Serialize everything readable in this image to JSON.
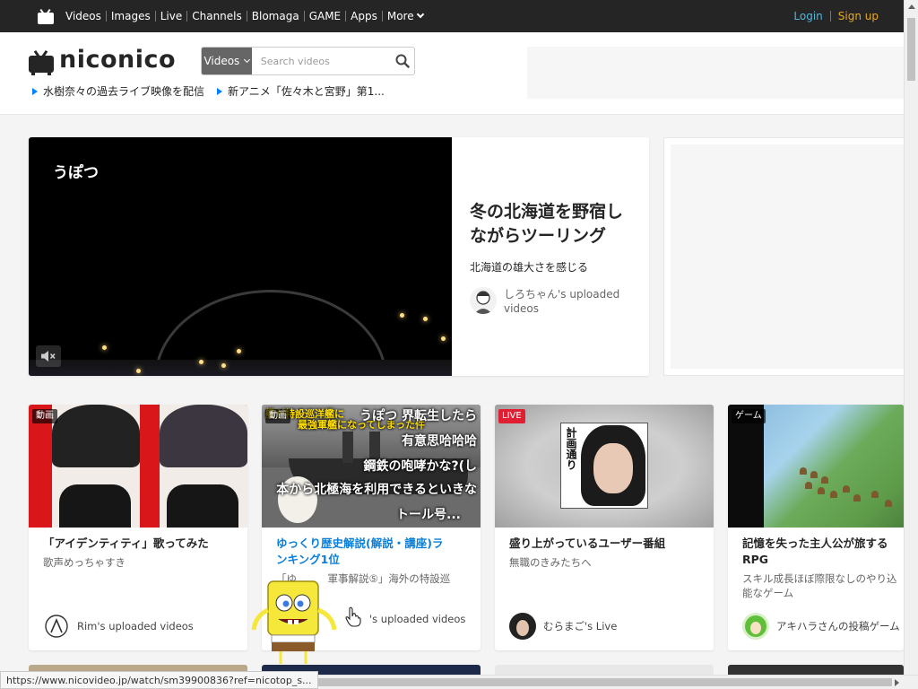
{
  "topbar": {
    "nav": [
      "Videos",
      "Images",
      "Live",
      "Channels",
      "Blomaga",
      "GAME",
      "Apps"
    ],
    "more_label": "More",
    "login": "Login",
    "signup": "Sign up"
  },
  "header": {
    "logo_text": "niconico",
    "search_category": "Videos",
    "search_placeholder": "Search videos",
    "news": [
      "水樹奈々の過去ライブ映像を配信",
      "新アニメ「佐々木と宮野」第1..."
    ]
  },
  "hero": {
    "video_label": "うぽつ",
    "title_line1": "冬の北海道を野宿し",
    "title_line2": "ながらツーリング",
    "subtitle": "北海道の雄大さを感じる",
    "owner_line1": "しろちゃん's uploaded",
    "owner_line2": "videos"
  },
  "cards": [
    {
      "badge": "動画",
      "title": "「アイデンティティ」歌ってみた",
      "desc": "歌声めっちゃすき",
      "owner": "Rim's uploaded videos"
    },
    {
      "badge": "動画",
      "title_line1": "ゆっくり歴史解説(解説・講座)ラ",
      "title_line2": "ンキング1位",
      "desc_line1": "「ゆ　　　軍事解説⑤」海外の特設巡",
      "desc_line2": "　　て",
      "owner": "'s uploaded videos",
      "overlay_lines": [
        "うぽつ 界転生したら",
        "有意思哈哈哈",
        "鋼鉄の咆哮かな?(し",
        "本から北極海を利用できるといきな",
        "トール号..."
      ],
      "overlay_top": "艦が特設巡洋艦に",
      "overlay_top2": "最強軍艦になってしまった件"
    },
    {
      "badge": "LIVE",
      "title": "盛り上がっているユーザー番組",
      "desc": "無職のきみたちへ",
      "owner": "むらまご's Live",
      "thumb_text": "計画通り"
    },
    {
      "badge": "ゲーム",
      "title_line1": "記憶を失った主人公が旅する",
      "title_line2": "RPG",
      "desc_line1": "スキル成長ほぼ際限なしのやり込",
      "desc_line2": "能なゲーム",
      "owner": "アキハラさんの投稿ゲーム"
    }
  ],
  "status_url": "https://www.nicovideo.jp/watch/sm39900836?ref=nicotop_s..."
}
